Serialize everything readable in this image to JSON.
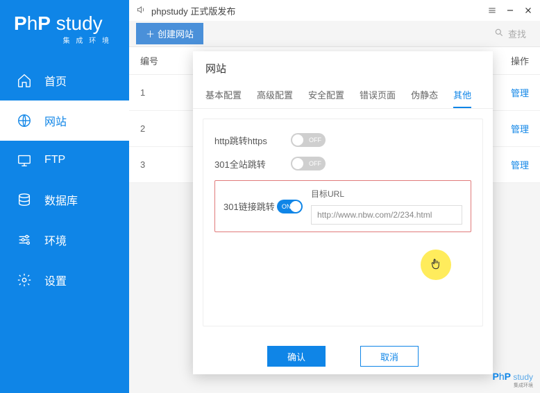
{
  "logo": {
    "brand_p1": "P",
    "brand_p2": "h",
    "brand_p3": "P",
    "brand_s": " study",
    "sub": "集 成 环 境"
  },
  "nav": {
    "home": "首页",
    "site": "网站",
    "ftp": "FTP",
    "db": "数据库",
    "env": "环境",
    "settings": "设置"
  },
  "titlebar": {
    "title": "phpstudy 正式版发布"
  },
  "toolbar": {
    "create": "创建网站",
    "search": "查找"
  },
  "table": {
    "head_num": "编号",
    "head_op": "操作",
    "rows": [
      "1",
      "2",
      "3"
    ],
    "manage": "管理"
  },
  "modal": {
    "title": "网站",
    "tabs": {
      "basic": "基本配置",
      "advanced": "高级配置",
      "security": "安全配置",
      "error": "错误页面",
      "pseudo": "伪静态",
      "other": "其他"
    },
    "http_redirect": "http跳转https",
    "full_301": "301全站跳转",
    "link_301": "301链接跳转",
    "off": "OFF",
    "on": "ON",
    "target_url_label": "目标URL",
    "target_url_value": "http://www.nbw.com/2/234.html",
    "confirm": "确认",
    "cancel": "取消"
  },
  "footer_logo": {
    "p1": "P",
    "p2": "h",
    "p3": "P",
    "s": " study",
    "sub": "集成环境"
  }
}
